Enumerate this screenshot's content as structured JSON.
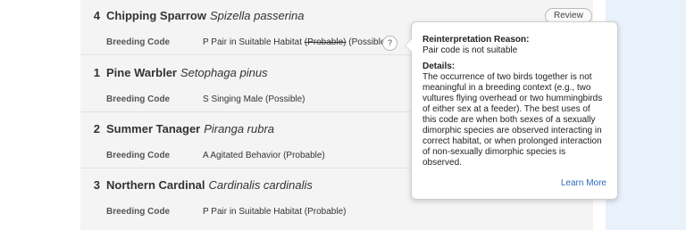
{
  "species_list": [
    {
      "count": "4",
      "common_name": "Chipping Sparrow",
      "scientific_name": "Spizella passerina",
      "review_label": "Review",
      "breeding_label": "Breeding Code",
      "breeding_value_prefix": "P Pair in Suitable Habitat ",
      "breeding_value_struck": "(Probable)",
      "breeding_value_suffix": " (Possible)",
      "help_label": "?"
    },
    {
      "count": "1",
      "common_name": "Pine Warbler",
      "scientific_name": "Setophaga pinus",
      "breeding_label": "Breeding Code",
      "breeding_value": "S Singing Male (Possible)"
    },
    {
      "count": "2",
      "common_name": "Summer Tanager",
      "scientific_name": "Piranga rubra",
      "breeding_label": "Breeding Code",
      "breeding_value": "A Agitated Behavior (Probable)"
    },
    {
      "count": "3",
      "common_name": "Northern Cardinal",
      "scientific_name": "Cardinalis cardinalis",
      "breeding_label": "Breeding Code",
      "breeding_value": "P Pair in Suitable Habitat (Probable)"
    }
  ],
  "tooltip": {
    "reason_heading": "Reinterpretation Reason:",
    "reason_text": "Pair code is not suitable",
    "details_heading": "Details:",
    "details_text": "The occurrence of two birds together is not meaningful in a breeding context (e.g., two vultures flying overhead or two hummingbirds of either sex at a feeder). The best uses of this code are when both sexes of a sexually dimorphic species are observed interacting in correct habitat, or when prolonged interaction of non-sexually dimorphic species is observed.",
    "learn_more": "Learn More"
  },
  "colors": {
    "list_background": "#f4f4f4",
    "side_panel": "#e9f1fa",
    "link": "#2b6bbd"
  }
}
